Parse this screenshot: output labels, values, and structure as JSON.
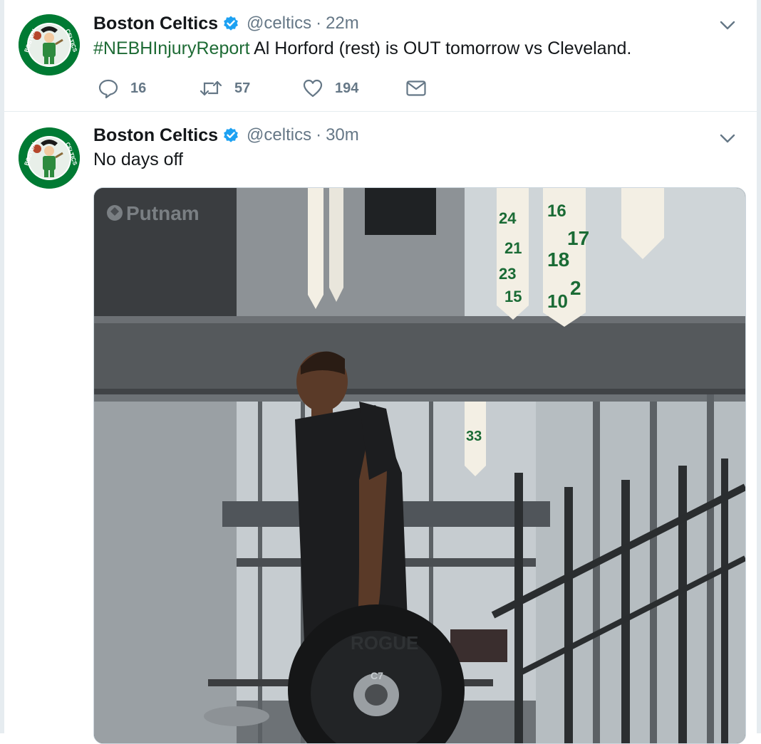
{
  "tweets": [
    {
      "author_name": "Boston Celtics",
      "handle": "@celtics",
      "separator": "·",
      "time": "22m",
      "hashtag": "#NEBHInjuryReport",
      "text": " Al Horford (rest) is OUT tomorrow vs Cleveland.",
      "replies": "16",
      "retweets": "57",
      "likes": "194"
    },
    {
      "author_name": "Boston Celtics",
      "handle": "@celtics",
      "separator": "·",
      "time": "30m",
      "text": "No days off",
      "media": {
        "watermark": "Putnam",
        "banners": [
          "24",
          "21",
          "23",
          "15",
          "16",
          "18",
          "17",
          "10",
          "2",
          "33"
        ],
        "plate_text": "ROGUE",
        "plate_number": "C7"
      }
    }
  ],
  "icons": {
    "verified": "verified-badge-icon",
    "caret": "chevron-down-icon",
    "reply": "reply-icon",
    "retweet": "retweet-icon",
    "like": "heart-icon",
    "dm": "envelope-icon"
  },
  "colors": {
    "hashtag": "#1e6b35",
    "verified": "#1da1f2",
    "secondary_text": "#657786",
    "celtics_green": "#007a33"
  }
}
